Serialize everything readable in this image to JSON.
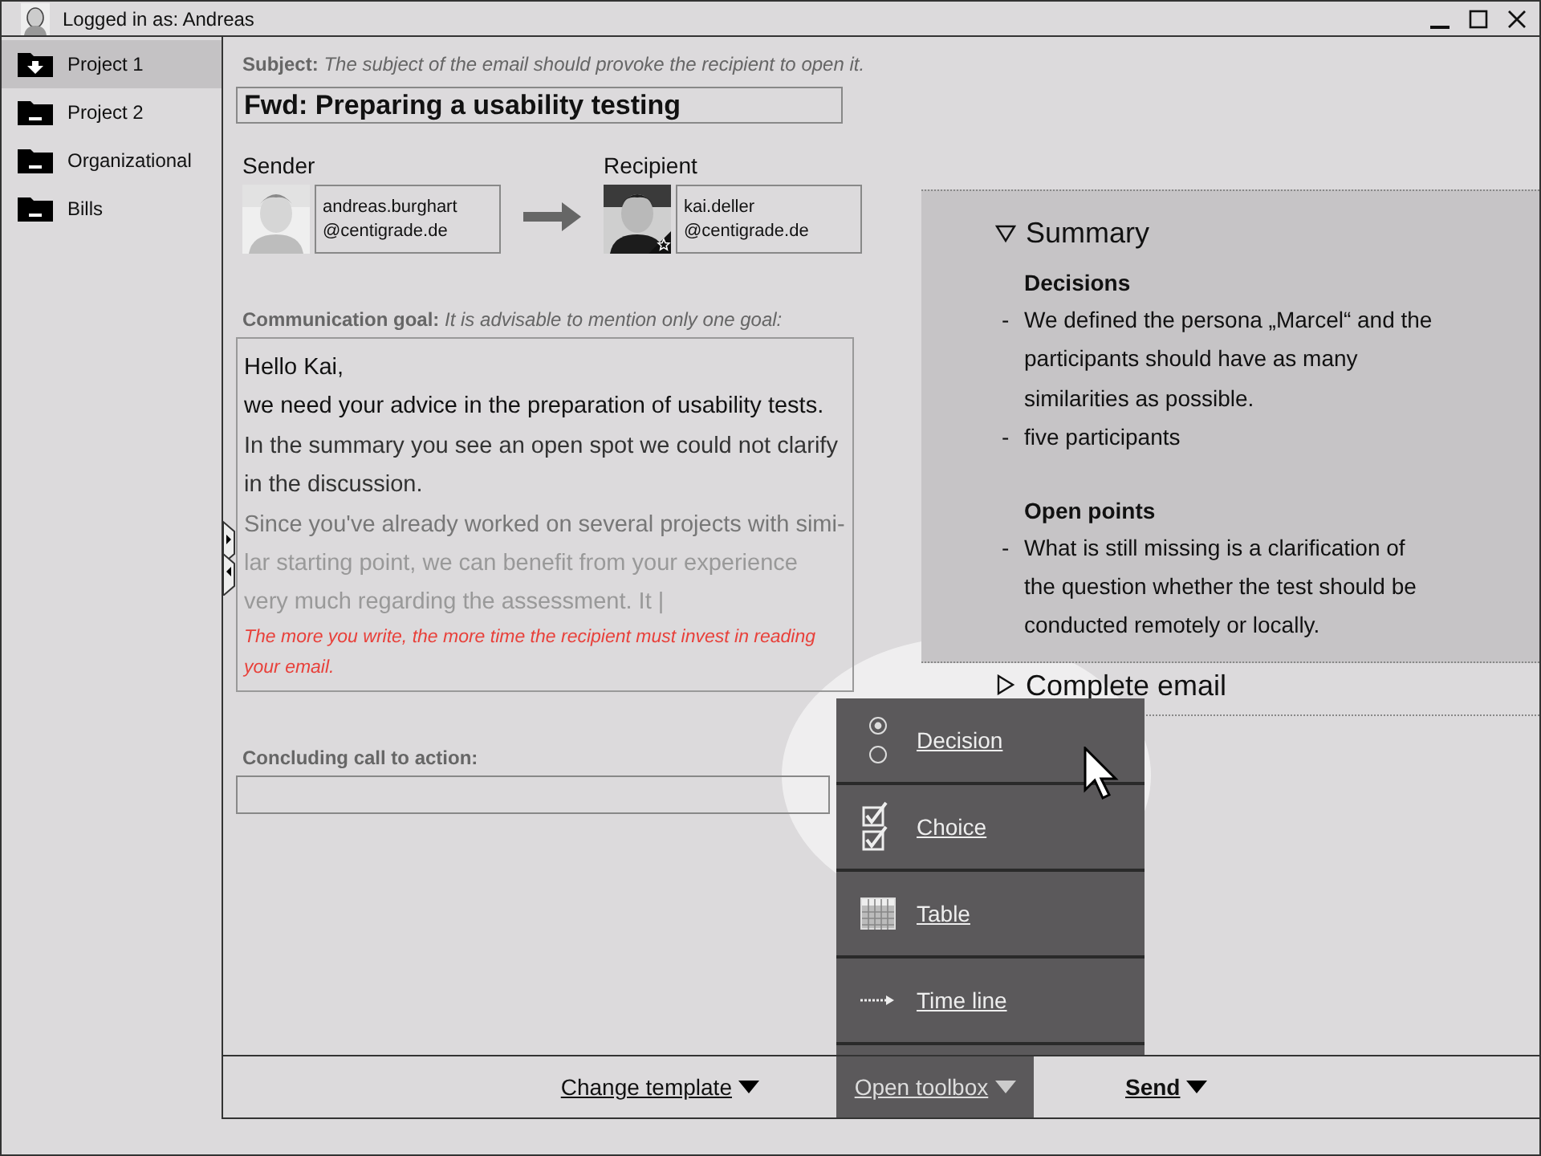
{
  "window": {
    "user_label": "Logged in as: Andreas"
  },
  "sidebar": {
    "items": [
      {
        "label": "Project 1",
        "selected": true
      },
      {
        "label": "Project 2",
        "selected": false
      },
      {
        "label": "Organizational",
        "selected": false
      },
      {
        "label": "Bills",
        "selected": false
      }
    ]
  },
  "subject": {
    "label": "**Subject:** *The subject of the email should provoke the recipient to open it.*",
    "value": "Fwd: Preparing a usability testing"
  },
  "sender": {
    "label": "Sender",
    "name": "andreas.burghart",
    "domain": "@centigrade.de"
  },
  "recipient": {
    "label": "Recipient",
    "name": "kai.deller",
    "domain": "@centigrade.de"
  },
  "goal": {
    "label": "**Communication goal:** *It is advisable to mention only one goal:*",
    "lines": [
      {
        "text": "Hello Kai,",
        "color": "#111111"
      },
      {
        "text": "we need your advice in the preparation of usability tests.",
        "color": "#111111"
      },
      {
        "text": "In the summary you see an open spot we could not clarify",
        "color": "#333333"
      },
      {
        "text": "in the discussion.",
        "color": "#333333"
      },
      {
        "text": "Since you've already worked on several projects with simi-",
        "color": "#777777"
      },
      {
        "text": "lar starting point, we can benefit from your experience",
        "color": "#999999"
      },
      {
        "text": "very much regarding the assessment. It |",
        "color": "#999999"
      }
    ],
    "hint": "The more you write, the more time the recipient must invest in reading your email."
  },
  "call_to_action": {
    "label": "Concluding call to action:"
  },
  "summary": {
    "title": "Summary",
    "expanded": true,
    "sections": [
      {
        "heading": "Decisions",
        "bullets": [
          {
            "marker": "-",
            "text": "We defined the persona „Marcel“ and the participants should have as many similarities as possible."
          },
          {
            "marker": "-",
            "text": "five participants"
          }
        ]
      },
      {
        "heading": "Open points",
        "bullets": [
          {
            "marker": "-",
            "text": "What is still missing is a clarification of the question whether the test should be conducted remotely or locally."
          }
        ]
      }
    ]
  },
  "complete_email": {
    "title": "Complete email",
    "expanded": false
  },
  "toolbox": {
    "items": [
      {
        "kind": "radio",
        "label": "Decision"
      },
      {
        "kind": "checkbox",
        "label": "Choice"
      },
      {
        "kind": "table",
        "label": "Table"
      },
      {
        "kind": "timeline",
        "label": "Time line"
      }
    ]
  },
  "bottom_bar": {
    "buttons": [
      {
        "kind": "plain",
        "label": "Change template"
      },
      {
        "kind": "toolbox",
        "label": "Open toolbox"
      },
      {
        "kind": "primary",
        "label": "Send"
      }
    ]
  }
}
